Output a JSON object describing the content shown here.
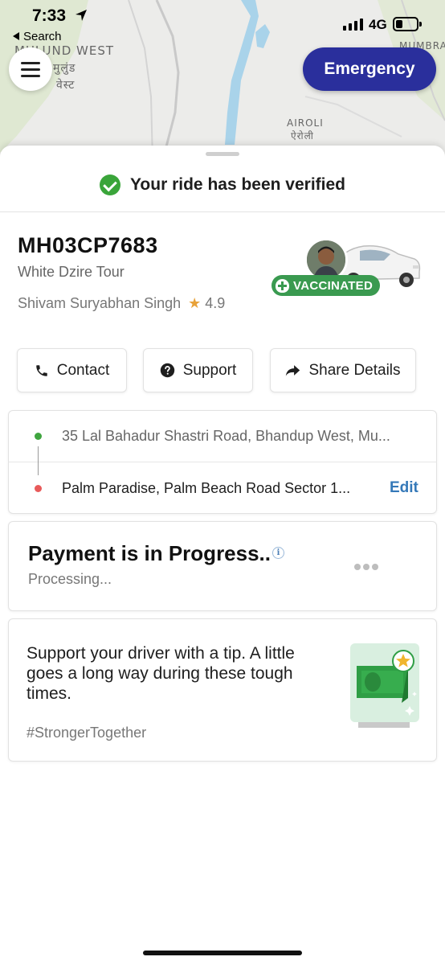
{
  "status_bar": {
    "time": "7:33",
    "back_label": "Search",
    "network": "4G"
  },
  "map": {
    "labels": {
      "area_west": "MULUND WEST",
      "area_west_local_1": "मुलुंड",
      "area_west_local_2": "वेस्ट",
      "airoli": "AIROLI",
      "airoli_local": "ऐरोली",
      "mumbra": "MUMBRA"
    }
  },
  "header": {
    "emergency_label": "Emergency"
  },
  "verification": {
    "message": "Your ride has been verified"
  },
  "vehicle": {
    "plate": "MH03CP7683",
    "model": "White Dzire Tour",
    "driver_name": "Shivam Suryabhan Singh",
    "rating": "4.9",
    "badge": "VACCINATED"
  },
  "actions": {
    "contact": "Contact",
    "support": "Support",
    "share": "Share Details"
  },
  "route": {
    "pickup": "35 Lal Bahadur Shastri Road, Bhandup West, Mu...",
    "drop": "Palm Paradise, Palm Beach Road Sector 1...",
    "edit_label": "Edit"
  },
  "payment": {
    "title": "Payment is in Progress..",
    "status": "Processing..."
  },
  "tip": {
    "message": "Support your driver with a tip. A little goes a long way during these tough times.",
    "hashtag": "#StrongerTogether"
  },
  "colors": {
    "emergency": "#2a2f9c",
    "verified_green": "#3aa53a",
    "badge_green": "#3a9a50",
    "edit_link": "#3478b8",
    "star": "#e8a23a"
  },
  "icons": {
    "menu": "hamburger-icon",
    "verified": "check-circle-icon",
    "contact": "phone-icon",
    "support": "help-circle-icon",
    "share": "share-arrow-icon",
    "more": "more-dots-icon",
    "info": "info-icon"
  }
}
